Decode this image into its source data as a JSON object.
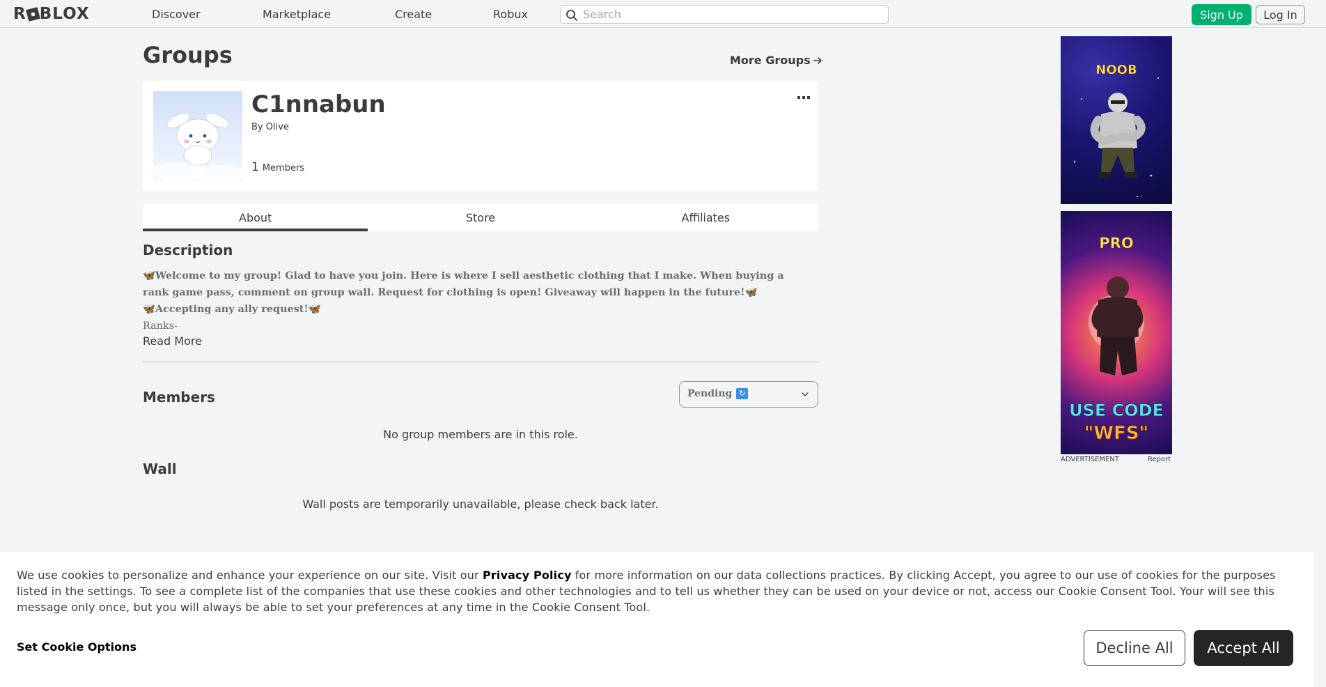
{
  "header": {
    "logo": "ROBLOX",
    "nav": [
      "Discover",
      "Marketplace",
      "Create",
      "Robux"
    ],
    "search_placeholder": "Search",
    "signup_label": "Sign Up",
    "login_label": "Log In"
  },
  "page": {
    "title": "Groups",
    "more_groups": "More Groups"
  },
  "group": {
    "name": "C1nnabun",
    "by_prefix": "By",
    "owner": "Olive",
    "member_count": "1",
    "members_label": "Members",
    "more_icon": "ellipsis-icon"
  },
  "tabs": [
    "About",
    "Store",
    "Affiliates"
  ],
  "about": {
    "description_heading": "Description",
    "description_lines": [
      "Welcome to my group! Glad to have you join. Here is where I sell aesthetic clothing that I make. When buying a",
      "rank game pass, comment on group wall. Request for clothing is open! Giveaway will happen in the future!",
      "Accepting any ally request!",
      "Ranks-"
    ],
    "read_more": "Read More"
  },
  "members": {
    "heading": "Members",
    "role_selected": "Pending",
    "empty_message": "No group members are in this role."
  },
  "wall": {
    "heading": "Wall",
    "message": "Wall posts are temporarily unavailable, please check back later."
  },
  "ads": {
    "ad1_text": "NOOB",
    "ad2_top": "PRO",
    "ad2_line1": "USE CODE",
    "ad2_line2": "\"WFS\"",
    "footer_label": "ADVERTISEMENT",
    "report_label": "Report"
  },
  "cookie": {
    "text_before": "We use cookies to personalize and enhance your experience on our site. Visit our ",
    "privacy_link": "Privacy Policy",
    "text_after": " for more information on our data collections practices. By clicking Accept, you agree to our use of cookies for the purposes listed in the settings. To see a complete list of the companies that use these cookies and other technologies and to tell us whether they can be used on your device or not, access our Cookie Consent Tool. Your will see this message only once, but you will always be able to set your preferences at any time in the Cookie Consent Tool.",
    "options_label": "Set Cookie Options",
    "decline_label": "Decline All",
    "accept_label": "Accept All"
  },
  "colors": {
    "signup_green": "#00b06f",
    "accept_dark": "#232527",
    "background": "#f2f4f5"
  }
}
